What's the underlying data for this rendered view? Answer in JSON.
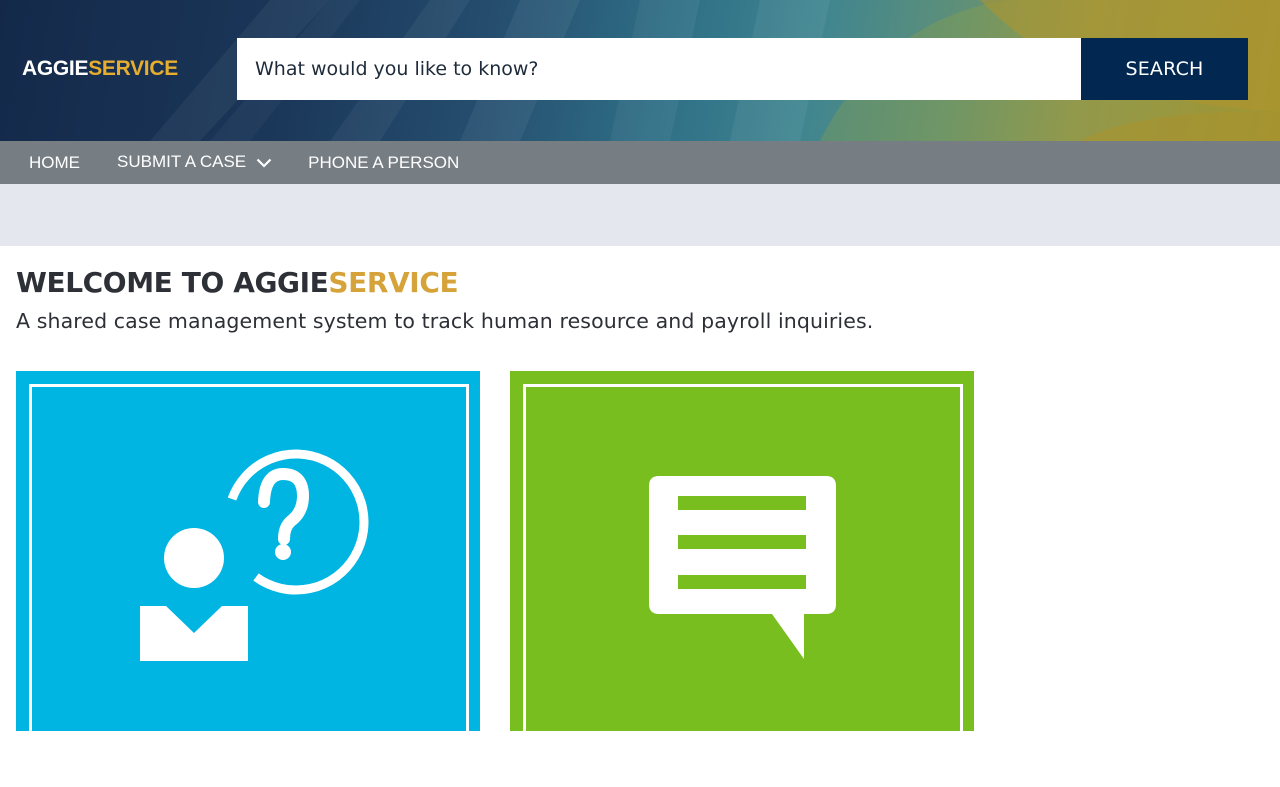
{
  "header": {
    "logo": {
      "part1": "AGGIE",
      "part2": "SERVICE"
    },
    "search": {
      "placeholder": "What would you like to know?",
      "button_label": "SEARCH"
    }
  },
  "nav": {
    "items": [
      {
        "label": "HOME"
      },
      {
        "label": "SUBMIT A CASE",
        "icon": "chevron-down-icon"
      },
      {
        "label": "PHONE A PERSON"
      }
    ]
  },
  "welcome": {
    "title_part1": "WELCOME TO AGGIE",
    "title_part2": "SERVICE",
    "subtitle": "A shared case management system to track human resource and payroll inquiries."
  },
  "tiles": [
    {
      "icon": "person-question-icon",
      "color": "#00b5e2"
    },
    {
      "icon": "chat-bubble-icon",
      "color": "#79be1f"
    }
  ],
  "colors": {
    "brand_navy": "#022851",
    "brand_gold": "#e6ad2f",
    "nav_gray": "#70787e",
    "band_gray": "#e4e7ee"
  }
}
